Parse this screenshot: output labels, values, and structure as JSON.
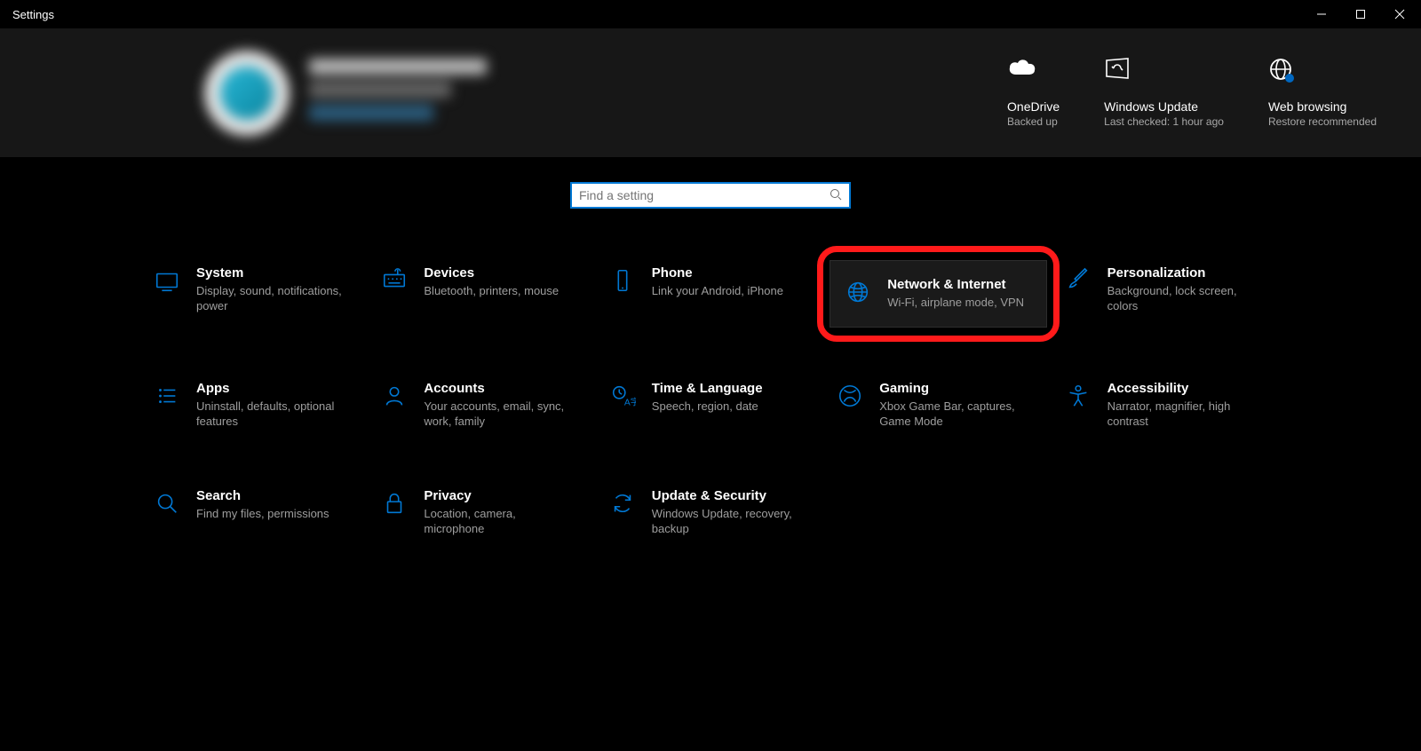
{
  "window": {
    "title": "Settings"
  },
  "status_cards": [
    {
      "title": "OneDrive",
      "subtitle": "Backed up"
    },
    {
      "title": "Windows Update",
      "subtitle": "Last checked: 1 hour ago"
    },
    {
      "title": "Web browsing",
      "subtitle": "Restore recommended"
    }
  ],
  "search": {
    "placeholder": "Find a setting"
  },
  "tiles": [
    {
      "key": "system",
      "title": "System",
      "desc": "Display, sound, notifications, power"
    },
    {
      "key": "devices",
      "title": "Devices",
      "desc": "Bluetooth, printers, mouse"
    },
    {
      "key": "phone",
      "title": "Phone",
      "desc": "Link your Android, iPhone"
    },
    {
      "key": "network",
      "title": "Network & Internet",
      "desc": "Wi-Fi, airplane mode, VPN",
      "highlight": true
    },
    {
      "key": "personalization",
      "title": "Personalization",
      "desc": "Background, lock screen, colors"
    },
    {
      "key": "apps",
      "title": "Apps",
      "desc": "Uninstall, defaults, optional features"
    },
    {
      "key": "accounts",
      "title": "Accounts",
      "desc": "Your accounts, email, sync, work, family"
    },
    {
      "key": "time",
      "title": "Time & Language",
      "desc": "Speech, region, date"
    },
    {
      "key": "gaming",
      "title": "Gaming",
      "desc": "Xbox Game Bar, captures, Game Mode"
    },
    {
      "key": "accessibility",
      "title": "Accessibility",
      "desc": "Narrator, magnifier, high contrast"
    },
    {
      "key": "search",
      "title": "Search",
      "desc": "Find my files, permissions"
    },
    {
      "key": "privacy",
      "title": "Privacy",
      "desc": "Location, camera, microphone"
    },
    {
      "key": "update",
      "title": "Update & Security",
      "desc": "Windows Update, recovery, backup"
    }
  ]
}
